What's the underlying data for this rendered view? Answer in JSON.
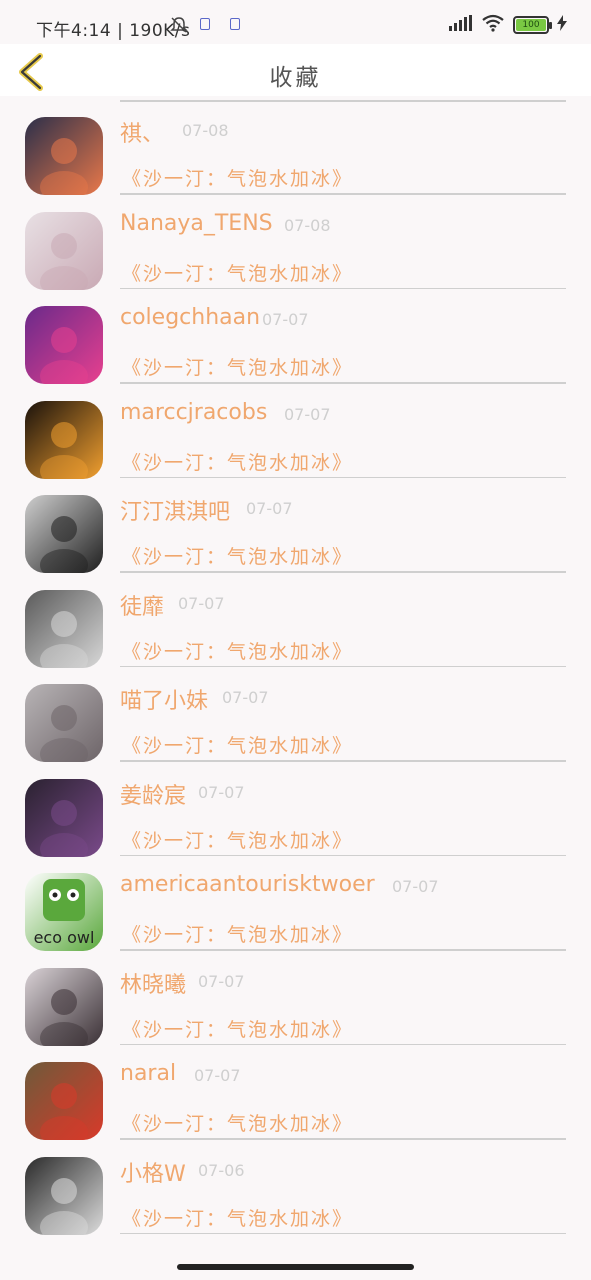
{
  "status_bar": {
    "time_speed": "下午4:14 | 190K/s",
    "battery": "100"
  },
  "header": {
    "title": "收藏",
    "back_icon": "chevron-left-icon"
  },
  "items": [
    {
      "name": "祺、",
      "date": "07-08",
      "title": "《沙一汀：气泡水加冰》",
      "avatar_colors": [
        "#2b2f4a",
        "#e9784a"
      ]
    },
    {
      "name": "Nanaya_TENS",
      "date": "07-08",
      "title": "《沙一汀：气泡水加冰》",
      "avatar_colors": [
        "#e8e0e4",
        "#c9a9b4"
      ]
    },
    {
      "name": "colegchhaan",
      "date": "07-07",
      "title": "《沙一汀：气泡水加冰》",
      "avatar_colors": [
        "#6a2a8a",
        "#e8408f"
      ]
    },
    {
      "name": "marccjracobs",
      "date": "07-07",
      "title": "《沙一汀：气泡水加冰》",
      "avatar_colors": [
        "#1a120c",
        "#f2a030"
      ]
    },
    {
      "name": "汀汀淇淇吧",
      "date": "07-07",
      "title": "《沙一汀：气泡水加冰》",
      "avatar_colors": [
        "#cfcfcf",
        "#1e1e1e"
      ]
    },
    {
      "name": "徒靡",
      "date": "07-07",
      "title": "《沙一汀：气泡水加冰》",
      "avatar_colors": [
        "#5a5a5a",
        "#d8d8d8"
      ]
    },
    {
      "name": "喵了小妹",
      "date": "07-07",
      "title": "《沙一汀：气泡水加冰》",
      "avatar_colors": [
        "#b8b4b6",
        "#6d6468"
      ]
    },
    {
      "name": "姜龄宸",
      "date": "07-07",
      "title": "《沙一汀：气泡水加冰》",
      "avatar_colors": [
        "#2a2230",
        "#7a4a8a"
      ]
    },
    {
      "name": "americaantourisktwoer",
      "date": "07-07",
      "title": "《沙一汀：气泡水加冰》",
      "avatar_colors": [
        "#ffffff",
        "#5aa83c"
      ],
      "avatar_text": "eco owl"
    },
    {
      "name": "林晓曦",
      "date": "07-07",
      "title": "《沙一汀：气泡水加冰》",
      "avatar_colors": [
        "#d9d2d6",
        "#3a3035"
      ]
    },
    {
      "name": "naral",
      "date": "07-07",
      "title": "《沙一汀：气泡水加冰》",
      "avatar_colors": [
        "#6e5a3a",
        "#d83a2a"
      ]
    },
    {
      "name": "小格W",
      "date": "07-06",
      "title": "《沙一汀：气泡水加冰》",
      "avatar_colors": [
        "#2a2a2a",
        "#dcdcdc"
      ]
    }
  ]
}
